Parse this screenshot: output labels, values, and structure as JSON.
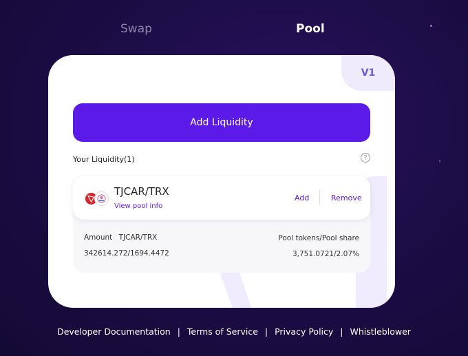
{
  "tabs": {
    "swap": "Swap",
    "pool": "Pool",
    "active": "Pool"
  },
  "card": {
    "version": "V1",
    "add_liquidity_label": "Add Liquidity",
    "your_liquidity_label": "Your Liquidity(1)",
    "help_icon": "?"
  },
  "position": {
    "token_a_icon": "tron-icon",
    "token_b_icon": "tjcar-token-icon",
    "pair": "TJCAR/TRX",
    "view_pool_info": "View pool info",
    "add_label": "Add",
    "remove_label": "Remove",
    "amount_label": "Amount",
    "amount_pair": "TJCAR/TRX",
    "amount_value": "342614.272/1694.4472",
    "share_label": "Pool tokens/Pool share",
    "share_value": "3,751.0721/2.07%"
  },
  "footer": {
    "links": [
      "Developer Documentation",
      "Terms of Service",
      "Privacy Policy",
      "Whistleblower"
    ],
    "separator": "|"
  },
  "colors": {
    "accent": "#5c1ae8",
    "background": "#1c0d47",
    "card": "#ffffff",
    "tron_red": "#d6262c"
  }
}
